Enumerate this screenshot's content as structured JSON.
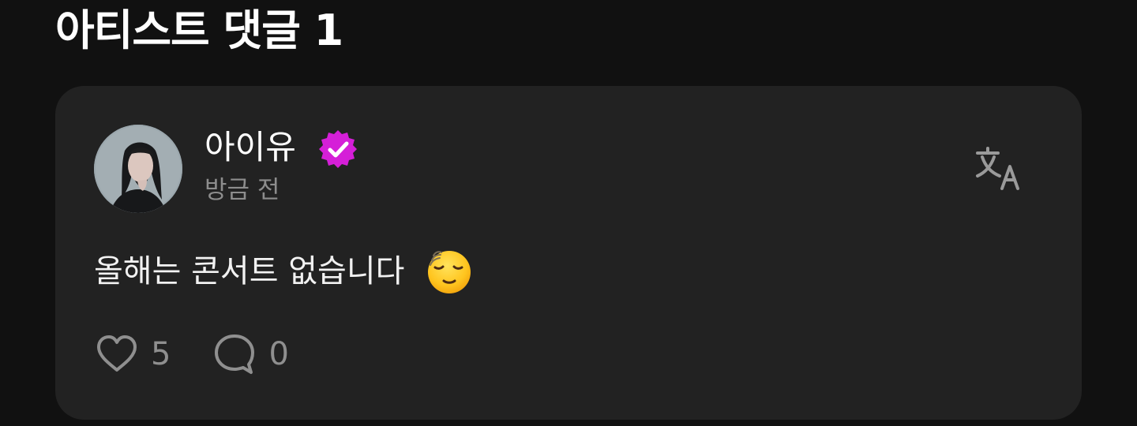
{
  "section": {
    "title": "아티스트 댓글 1"
  },
  "comment": {
    "author": "아이유",
    "timestamp": "방금 전",
    "text": "올해는 콘서트 없습니다",
    "emoji": "relieved-face",
    "like_count": "5",
    "reply_count": "0"
  },
  "icons": {
    "verified": "verified-badge-icon",
    "translate": "translate-icon",
    "like": "heart-icon",
    "reply": "speech-bubble-icon"
  },
  "colors": {
    "background": "#111111",
    "card": "#222222",
    "verified_badge": "#d51fd8",
    "muted_text": "#8d8d8d"
  }
}
